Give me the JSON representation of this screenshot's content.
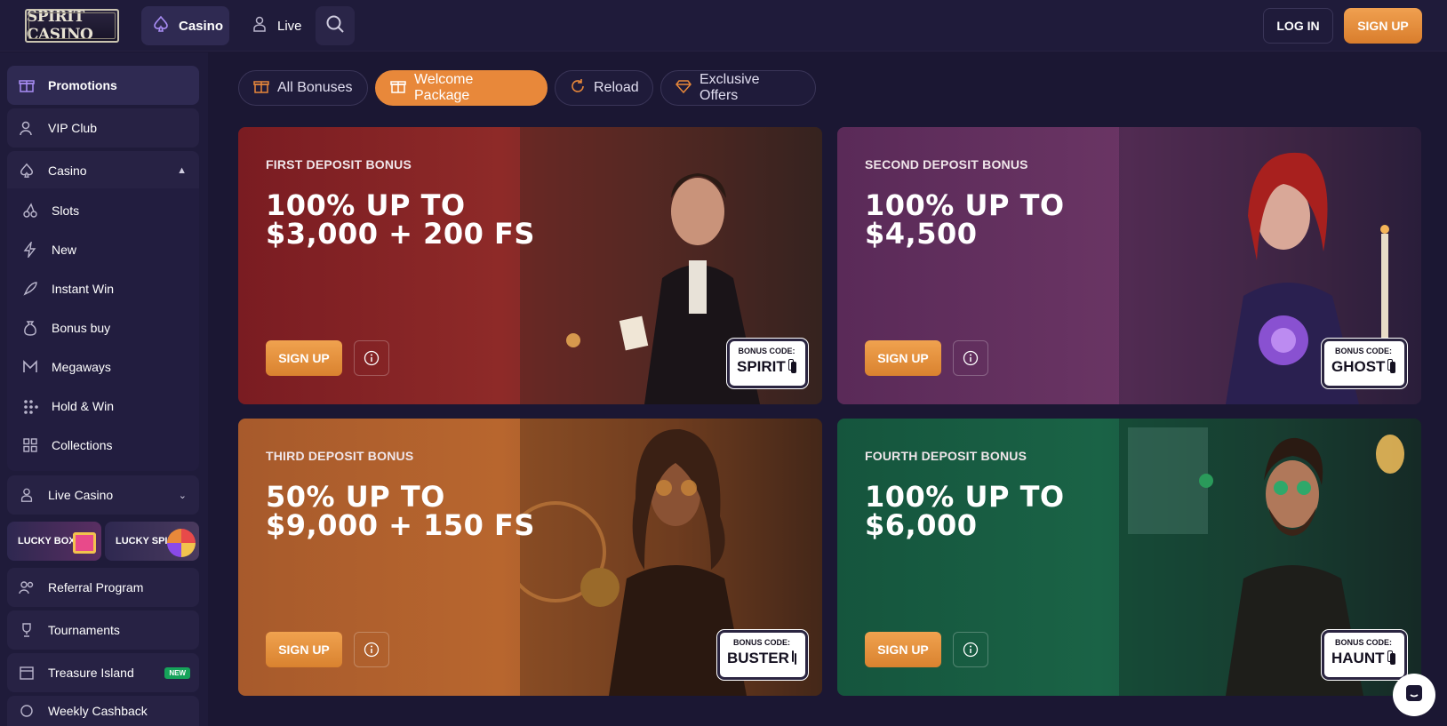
{
  "header": {
    "logo_text": "SPIRIT CASINO",
    "nav_casino": "Casino",
    "nav_live": "Live",
    "login": "LOG IN",
    "signup": "SIGN UP"
  },
  "sidebar": {
    "promotions": "Promotions",
    "vip": "VIP Club",
    "casino": "Casino",
    "sub": [
      "Slots",
      "New",
      "Instant Win",
      "Bonus buy",
      "Megaways",
      "Hold & Win",
      "Collections"
    ],
    "live_casino": "Live Casino",
    "lucky_box": "LUCKY BOX",
    "lucky_spin": "LUCKY SPIN",
    "referral": "Referral Program",
    "tournaments": "Tournaments",
    "treasure": "Treasure Island",
    "new_badge": "NEW",
    "weekly": "Weekly Cashback"
  },
  "filters": [
    "All Bonuses",
    "Welcome Package",
    "Reload",
    "Exclusive Offers"
  ],
  "cards": [
    {
      "kicker": "FIRST DEPOSIT BONUS",
      "title": "100% UP TO $3,000 + 200 FS",
      "signup": "SIGN UP",
      "code_label": "BONUS CODE:",
      "code": "SPIRIT"
    },
    {
      "kicker": "SECOND DEPOSIT BONUS",
      "title": "100% UP TO $4,500",
      "signup": "SIGN UP",
      "code_label": "BONUS CODE:",
      "code": "GHOST"
    },
    {
      "kicker": "THIRD DEPOSIT BONUS",
      "title": "50% UP TO $9,000 + 150 FS",
      "signup": "SIGN UP",
      "code_label": "BONUS CODE:",
      "code": "BUSTER"
    },
    {
      "kicker": "FOURTH DEPOSIT BONUS",
      "title": "100% UP TO $6,000",
      "signup": "SIGN UP",
      "code_label": "BONUS CODE:",
      "code": "HAUNT"
    }
  ],
  "colors": {
    "accent": "#e8883a",
    "bg": "#1b1733",
    "new_badge": "#16a35a"
  }
}
